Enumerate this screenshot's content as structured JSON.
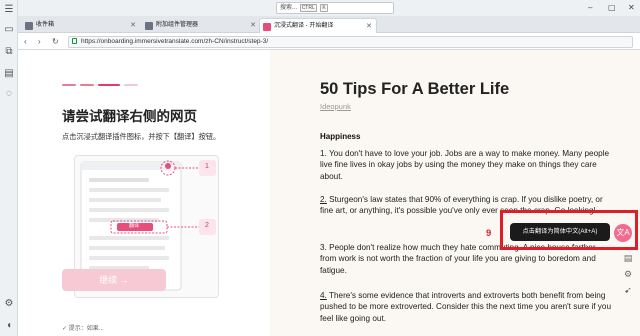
{
  "browser": {
    "search_placeholder": "搜索...",
    "search_key": "CTRL",
    "search_key2": "K",
    "win_controls": [
      "–",
      "▢",
      "✕"
    ],
    "tabs": [
      {
        "label": "收件箱",
        "close": "✕",
        "color": "#6b7280"
      },
      {
        "label": "附加组件管理器",
        "close": "✕",
        "color": "#6b7280"
      },
      {
        "label": "沉浸式翻译 - 开始翻译",
        "close": "✕",
        "color": "#e84e7c"
      }
    ],
    "url": "https://onboarding.immersivetranslate.com/zh-CN/instruct/step-3/",
    "nav": [
      "‹",
      "›",
      "↻"
    ]
  },
  "onboarding": {
    "heading": "请尝试翻译右侧的网页",
    "subtitle": "点击沉浸式翻译插件图标，并按下【翻译】按钮。",
    "illu_step1": "1",
    "illu_step2": "2",
    "illu_btn": "翻译",
    "continue_label": "继续 →",
    "footer_hint": "✓ 提示：如果..."
  },
  "article": {
    "title": "50 Tips For A Better Life",
    "author": "Ideopunk",
    "section": "Happiness",
    "tips": [
      {
        "num": "1.",
        "text": " You don't have to love your job. Jobs are a way to make money. Many people live fine lives in okay jobs by using the money they make on things they care about."
      },
      {
        "num": "2.",
        "text": " Sturgeon's law states that 90% of everything is crap. If you dislike poetry, or fine art, or anything, it's possible you've only ever seen the crap. Go looking!"
      },
      {
        "num": "3.",
        "text": " People don't realize how much they hate commuting. A nice house farther from work is not worth the fraction of your life you are giving to boredom and fatigue."
      },
      {
        "num": "4.",
        "text": " There's some evidence that introverts and extroverts both benefit from being pushed to be more extroverted. Consider this the next time you aren't sure if you feel like going out."
      }
    ]
  },
  "overlay": {
    "marker_number": "9",
    "translate_button": "点击翻译为简体中文(Alt+A)",
    "fab_icon": "文A",
    "accent": "#e84e7c",
    "highlight": "#e01e28"
  }
}
